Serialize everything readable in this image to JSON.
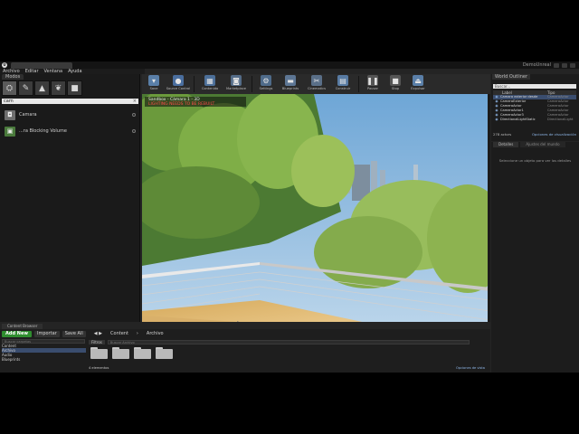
{
  "window": {
    "project_name": "DemoUnreal",
    "menu": [
      "Archivo",
      "Editar",
      "Ventana",
      "Ayuda"
    ]
  },
  "modes_panel": {
    "tab_label": "Modos",
    "mode_icons": [
      "place-mode-icon",
      "paint-mode-icon",
      "landscape-mode-icon",
      "foliage-mode-icon",
      "geometry-mode-icon"
    ],
    "search_value": "cam",
    "items": [
      {
        "label": "Camara",
        "icon": "camera-icon"
      },
      {
        "label": "...ra Blocking Volume",
        "icon": "volume-icon"
      }
    ]
  },
  "toolbar": {
    "buttons": [
      {
        "label": "Save",
        "icon": "save-icon",
        "color": "#5a7fa8"
      },
      {
        "label": "Source Control",
        "icon": "source-control-icon",
        "color": "#4a6e9e"
      },
      {
        "label": "Contenido",
        "icon": "content-icon",
        "color": "#4c6f99"
      },
      {
        "label": "Marketplace",
        "icon": "marketplace-icon",
        "color": "#546c88"
      },
      {
        "label": "Settings",
        "icon": "settings-icon",
        "color": "#4f6b8a"
      },
      {
        "label": "Blueprints",
        "icon": "blueprints-icon",
        "color": "#5d7694"
      },
      {
        "label": "Cinematics",
        "icon": "cinematics-icon",
        "color": "#5a6f88"
      },
      {
        "label": "Construir",
        "icon": "build-icon",
        "color": "#587ba3"
      },
      {
        "label": "Pausar",
        "icon": "pause-icon",
        "color": "#555555"
      },
      {
        "label": "Stop",
        "icon": "stop-icon",
        "color": "#555555"
      },
      {
        "label": "Expulsar",
        "icon": "eject-icon",
        "color": "#5a7fa8"
      }
    ]
  },
  "viewport": {
    "status_line": "Sandbox - Cámara 1 - 3D",
    "warning_line": "LIGHTING NEEDS TO BE REBUILT"
  },
  "world_outliner": {
    "tab_label": "World Outliner",
    "search_placeholder": "Buscar...",
    "col_label": "Label",
    "col_type": "Tipo",
    "rows": [
      {
        "name": "Camara exterior desde",
        "type": "CameraActor",
        "selected": true
      },
      {
        "name": "CameraExterior",
        "type": "CameraActor",
        "selected": false
      },
      {
        "name": "CameraActor",
        "type": "CameraActor",
        "selected": false
      },
      {
        "name": "CameraActor1",
        "type": "CameraActor",
        "selected": false
      },
      {
        "name": "CameraActor3",
        "type": "CameraActor",
        "selected": false
      },
      {
        "name": "DirectionalLightStatic",
        "type": "DirectionalLight",
        "selected": false
      }
    ],
    "actor_count": "278 actors",
    "view_options": "Opciones de visualización"
  },
  "details": {
    "tab_details": "Detalles",
    "tab_world": "Ajustes del mundo",
    "empty_message": "Seleccione un objeto para ver los detalles"
  },
  "content_browser": {
    "tab_label": "Content Browser",
    "add_new": "Add New",
    "import": "Importar",
    "save_all": "Save All",
    "breadcrumb": [
      "Content",
      "Archivo"
    ],
    "tree_search_placeholder": "Buscar carpetas",
    "tree": [
      {
        "label": "Content",
        "selected": false
      },
      {
        "label": "Archivo",
        "selected": true
      },
      {
        "label": "Audio",
        "selected": false
      },
      {
        "label": "Blueprints",
        "selected": false
      }
    ],
    "filters_label": "Filtros",
    "asset_search_placeholder": "Buscar Archivo",
    "folder_count": 4,
    "items_count": "4 elementos",
    "view_options": "Opciones de vista"
  }
}
